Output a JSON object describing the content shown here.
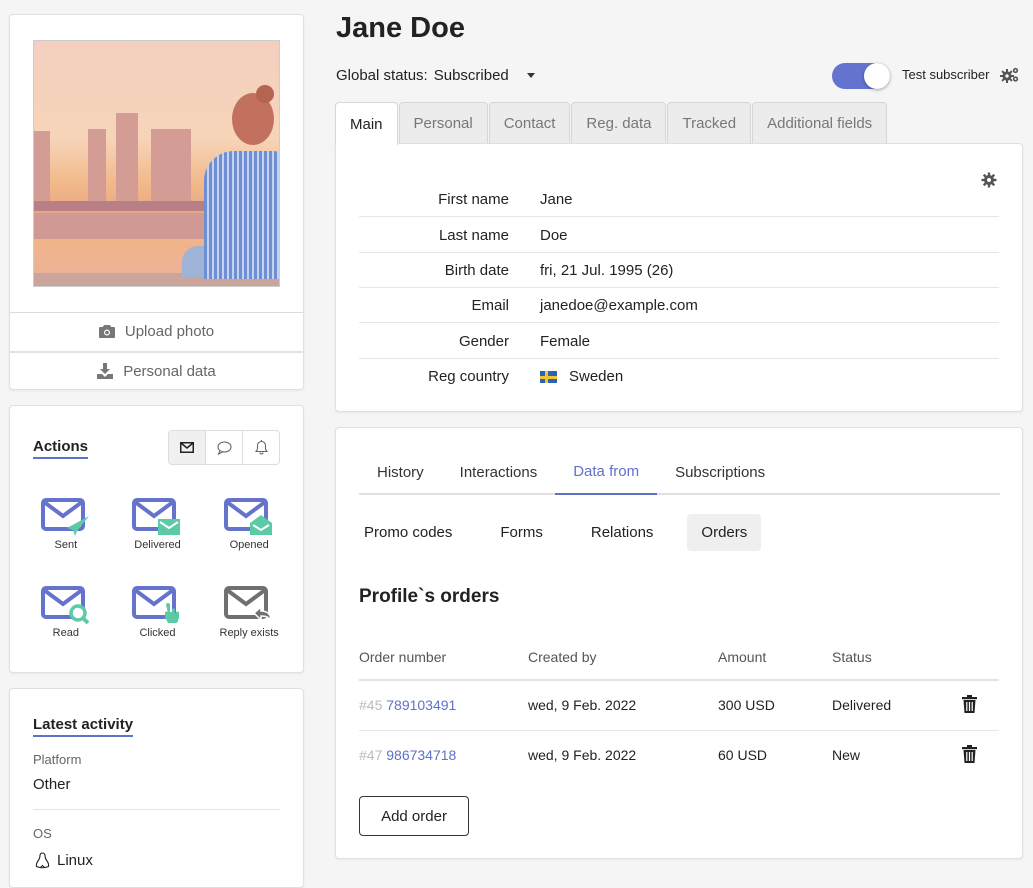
{
  "profile": {
    "name": "Jane Doe",
    "global_status_label": "Global status:",
    "global_status_value": "Subscribed",
    "test_subscriber_label": "Test subscriber",
    "test_subscriber_on": true
  },
  "photo_card": {
    "upload_photo_label": "Upload photo",
    "personal_data_label": "Personal data"
  },
  "actions": {
    "title": "Actions",
    "channels": [
      "email-icon",
      "chat-icon",
      "bell-icon"
    ],
    "active_channel": "email",
    "items": [
      {
        "label": "Sent",
        "icon": "mail-sent-icon"
      },
      {
        "label": "Delivered",
        "icon": "mail-delivered-icon"
      },
      {
        "label": "Opened",
        "icon": "mail-opened-icon"
      },
      {
        "label": "Read",
        "icon": "mail-read-icon"
      },
      {
        "label": "Clicked",
        "icon": "mail-clicked-icon"
      },
      {
        "label": "Reply exists",
        "icon": "mail-reply-icon"
      }
    ],
    "colors": {
      "envelope": "#6673cc",
      "badge": "#5ccaa5",
      "inactive": "#707070"
    }
  },
  "latest_activity": {
    "title": "Latest activity",
    "platform_label": "Platform",
    "platform_value": "Other",
    "os_label": "OS",
    "os_value": "Linux"
  },
  "main_tabs": [
    {
      "label": "Main",
      "active": true
    },
    {
      "label": "Personal"
    },
    {
      "label": "Contact"
    },
    {
      "label": "Reg. data"
    },
    {
      "label": "Tracked"
    },
    {
      "label": "Additional fields"
    }
  ],
  "fields": [
    {
      "label": "First name",
      "value": "Jane"
    },
    {
      "label": "Last name",
      "value": "Doe"
    },
    {
      "label": "Birth date",
      "value": "fri, 21 Jul. 1995 (26)"
    },
    {
      "label": "Email",
      "value": "janedoe@example.com"
    },
    {
      "label": "Gender",
      "value": "Female"
    },
    {
      "label": "Reg country",
      "value": "Sweden",
      "flag": "sweden-flag-icon"
    }
  ],
  "data_tabs": [
    {
      "label": "History"
    },
    {
      "label": "Interactions"
    },
    {
      "label": "Data from",
      "active": true
    },
    {
      "label": "Subscriptions"
    }
  ],
  "data_subtabs": [
    {
      "label": "Promo codes"
    },
    {
      "label": "Forms"
    },
    {
      "label": "Relations"
    },
    {
      "label": "Orders",
      "active": true
    }
  ],
  "orders": {
    "title": "Profile`s orders",
    "columns": [
      "Order number",
      "Created by",
      "Amount",
      "Status"
    ],
    "rows": [
      {
        "prefix": "#45",
        "number": "789103491",
        "created": "wed, 9 Feb. 2022",
        "amount": "300 USD",
        "status": "Delivered"
      },
      {
        "prefix": "#47",
        "number": "986734718",
        "created": "wed, 9 Feb. 2022",
        "amount": "60 USD",
        "status": "New"
      }
    ],
    "add_label": "Add order"
  },
  "colors": {
    "accent": "#5e72c8",
    "toggle": "#6473cf",
    "background": "#f5f5f5"
  }
}
